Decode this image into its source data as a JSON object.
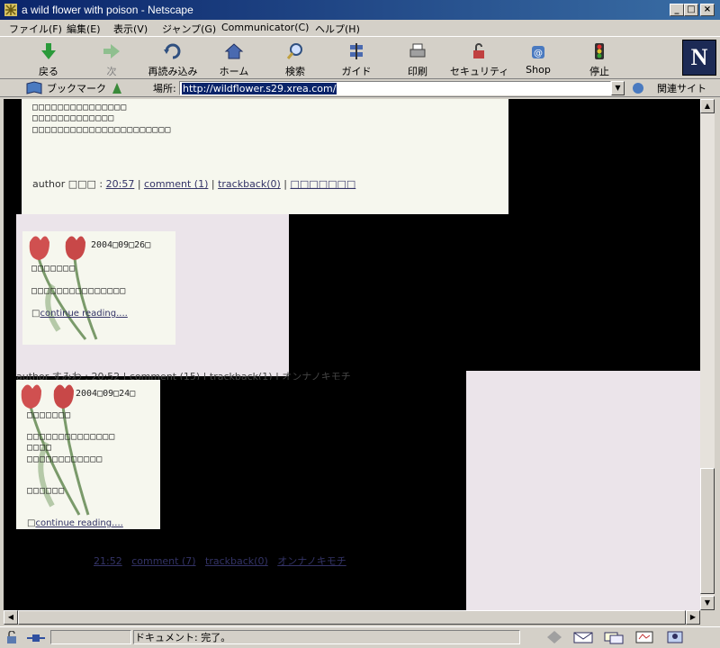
{
  "window": {
    "title": "a wild flower with poison - Netscape"
  },
  "menu": [
    "ファイル(F)",
    "編集(E)",
    "表示(V)",
    "ジャンプ(G)",
    "Communicator(C)",
    "ヘルプ(H)"
  ],
  "toolbar": [
    {
      "label": "戻る",
      "icon": "back-arrow-icon"
    },
    {
      "label": "次",
      "icon": "forward-arrow-icon"
    },
    {
      "label": "再読み込み",
      "icon": "reload-icon"
    },
    {
      "label": "ホーム",
      "icon": "home-icon"
    },
    {
      "label": "検索",
      "icon": "search-icon"
    },
    {
      "label": "ガイド",
      "icon": "guide-icon"
    },
    {
      "label": "印刷",
      "icon": "print-icon"
    },
    {
      "label": "セキュリティ",
      "icon": "security-lock-icon"
    },
    {
      "label": "Shop",
      "icon": "shop-icon"
    },
    {
      "label": "停止",
      "icon": "stop-icon"
    }
  ],
  "location": {
    "bookmark_label": "ブックマーク",
    "location_label": "場所:",
    "url": "http://wildflower.s29.xrea.com/",
    "related_label": "関連サイト"
  },
  "posts": {
    "p1": {
      "lines": [
        "□□□□□□□□□□□□□□□",
        "□□□□□□□□□□□□□",
        "□□□□□□□□□□□□□□□□□□□□□□"
      ],
      "author_prefix": "author □□□ :",
      "time": "20:57",
      "comment": "comment (1)",
      "trackback": "trackback(0)",
      "category": "□□□□□□□"
    },
    "p2": {
      "date": "2004□09□26□",
      "line1": "□□□□□□□",
      "line2": "□□□□□□□□□□□□□□□",
      "continue": "continue reading....",
      "meta_overlap": "author すみわ : 20:52 | comment (15) | trackback(1) | オンナノキモチ"
    },
    "p3": {
      "date": "2004□09□24□",
      "line1": "□□□□□□□",
      "line2": "□□□□□□□□□□□□□□",
      "line3": "□□□□",
      "line4": "□□□□□□□□□□□□",
      "line5": "□□□□□□",
      "continue": "continue reading....",
      "time": "21:52",
      "comment": "comment (7)",
      "trackback": "trackback(0)",
      "category": "オンナノキモチ"
    }
  },
  "status": {
    "text": "ドキュメント: 完了。"
  },
  "colors": {
    "titlebar": "#0a246a",
    "panel": "#f6f7ee",
    "pink": "#ebe4ea",
    "link": "#336"
  }
}
